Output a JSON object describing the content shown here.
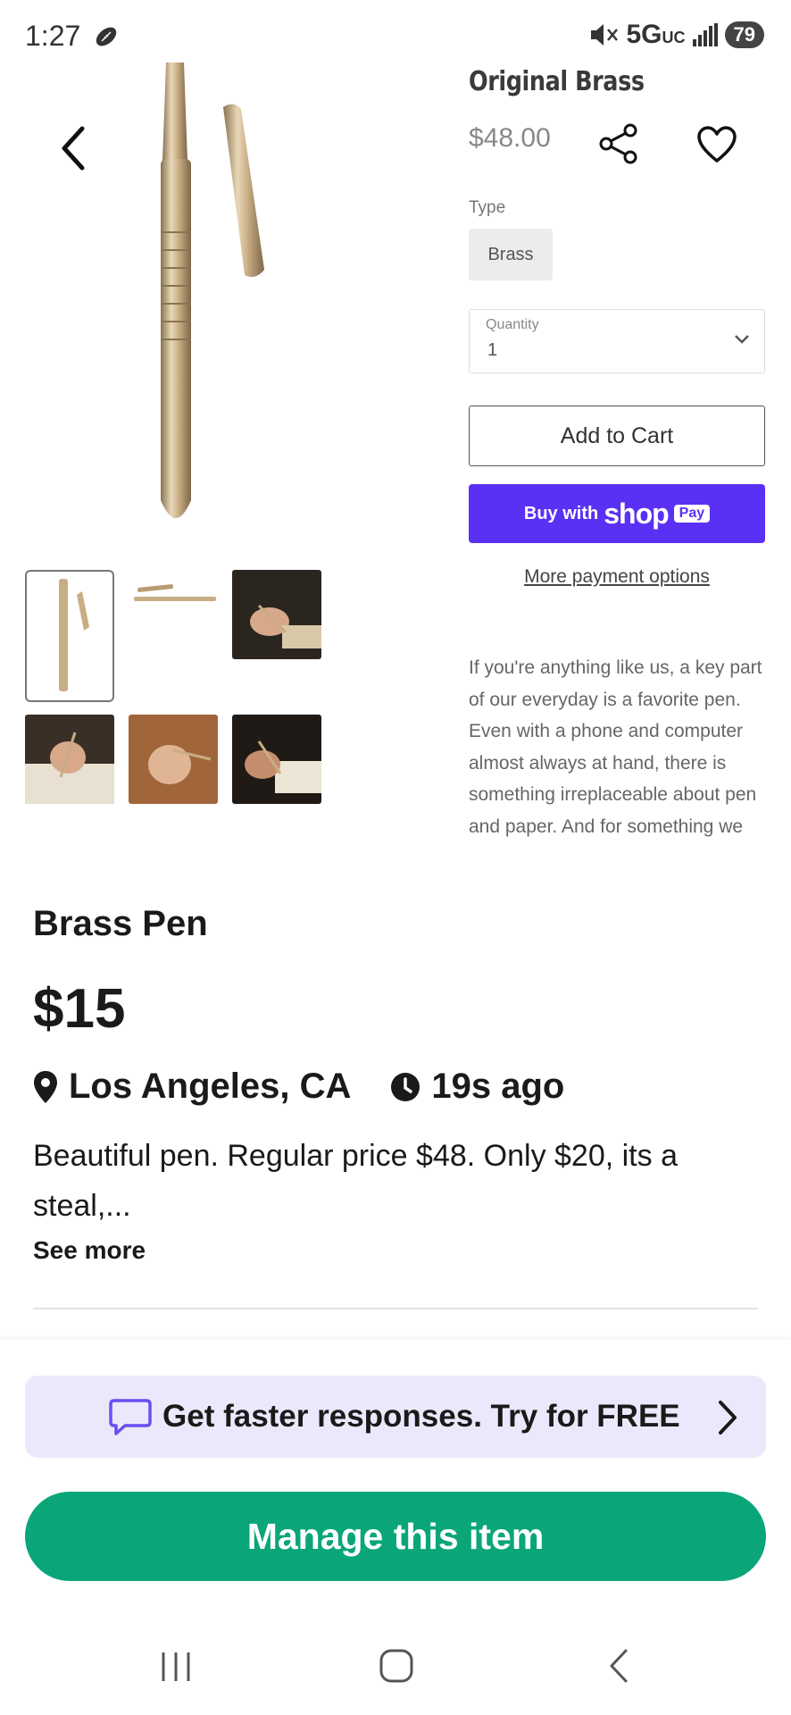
{
  "status_bar": {
    "time": "1:27",
    "network": "5G",
    "network_sub": "UC",
    "battery": "79"
  },
  "shop_page": {
    "title": "Original Brass",
    "price": "$48.00",
    "type_label": "Type",
    "type_value": "Brass",
    "quantity_label": "Quantity",
    "quantity_value": "1",
    "add_to_cart": "Add to Cart",
    "buy_with": "Buy with",
    "shop_word": "shop",
    "pay_word": "Pay",
    "more_payment": "More payment options",
    "description": "If you're anything like us, a key part of our everyday is a favorite pen. Even with a phone and computer almost always at hand, there is something irreplaceable about pen and paper. And for something we"
  },
  "listing": {
    "title": "Brass Pen",
    "price": "$15",
    "location": "Los Angeles, CA",
    "posted": "19s ago",
    "description": "Beautiful pen. Regular price $48. Only $20, its a steal,...",
    "see_more": "See more"
  },
  "promo": {
    "text": "Get faster responses. Try for FREE"
  },
  "manage_button": "Manage this item",
  "colors": {
    "brand_green": "#0aa67a",
    "promo_bg": "#ece8fc",
    "shop_pay_purple": "#5a31f4"
  }
}
